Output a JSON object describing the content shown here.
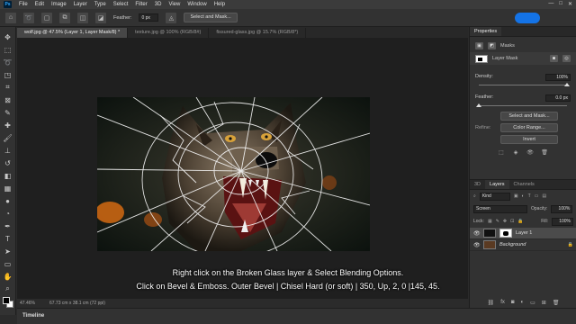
{
  "menubar": {
    "logo": "Ps",
    "items": [
      "File",
      "Edit",
      "Image",
      "Layer",
      "Type",
      "Select",
      "Filter",
      "3D",
      "View",
      "Window",
      "Help"
    ],
    "window_controls": [
      "—",
      "□",
      "✕"
    ]
  },
  "options": {
    "feather_label": "Feather:",
    "feather_value": "0 px",
    "select_mask_label": "Select and Mask..."
  },
  "tabs": [
    {
      "label": "wolf.jpg @ 47.5% (Layer 1, Layer Mask/8) *",
      "active": true
    },
    {
      "label": "texture.jpg @ 100% (RGB/8#)",
      "active": false
    },
    {
      "label": "fissured-glass.jpg @ 15.7% (RGB/8*)",
      "active": false
    }
  ],
  "status": {
    "zoom": "47.46%",
    "doc_size": "67.73 cm x 38.1 cm (72 ppi)"
  },
  "timeline_label": "Timeline",
  "caption": {
    "line1": "Right click on the Broken Glass layer & Select Blending Options.",
    "line2": "Click on Bevel & Emboss. Outer Bevel | Chisel Hard (or soft) | 350, Up, 2, 0 |145, 45."
  },
  "properties": {
    "tab_label": "Properties",
    "masks_label": "Masks",
    "layer_mask_label": "Layer Mask",
    "density_label": "Density:",
    "density_value": "100%",
    "density_level": 1.0,
    "feather_label": "Feather:",
    "feather_value": "0.0 px",
    "feather_level": 0.0,
    "refine_label": "Refine:",
    "select_mask_btn": "Select and Mask...",
    "color_range_btn": "Color Range...",
    "invert_btn": "Invert"
  },
  "layers": {
    "tabs": [
      {
        "label": "3D",
        "active": false
      },
      {
        "label": "Layers",
        "active": true
      },
      {
        "label": "Channels",
        "active": false
      }
    ],
    "kind_label": "Kind",
    "blend_mode": "Screen",
    "opacity_label": "Opacity:",
    "opacity_value": "100%",
    "lock_label": "Lock:",
    "fill_label": "Fill:",
    "fill_value": "100%",
    "items": [
      {
        "name": "Layer 1",
        "selected": true
      },
      {
        "name": "Background",
        "selected": false
      }
    ]
  },
  "colors": {
    "accent": "#1473e6",
    "panel_bg": "#323232",
    "canvas_bg": "#1f1f1f"
  }
}
